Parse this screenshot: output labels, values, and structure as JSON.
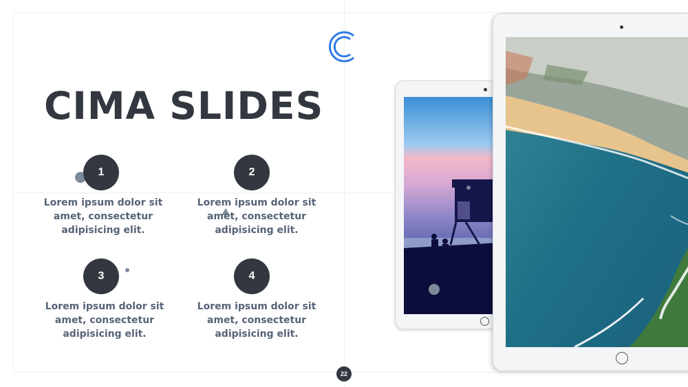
{
  "slide": {
    "title": "CIMA SLIDES",
    "page_number": "22",
    "accent_color": "#2f7be5",
    "dark_color": "#333740",
    "text_color": "#566377"
  },
  "points": [
    {
      "number": "1",
      "text": "Lorem ipsum dolor sit amet, consectetur adipisicing elit."
    },
    {
      "number": "2",
      "text": "Lorem ipsum dolor sit amet, consectetur adipisicing elit."
    },
    {
      "number": "3",
      "text": "Lorem ipsum dolor sit amet, consectetur adipisicing elit."
    },
    {
      "number": "4",
      "text": "Lorem ipsum dolor sit amet, consectetur adipisicing elit."
    }
  ],
  "logo": {
    "icon": "cima-c-logo-icon"
  },
  "images": [
    {
      "icon": "tablet-sunset-lifeguard-tower-image"
    },
    {
      "icon": "tablet-aerial-beach-image"
    }
  ]
}
